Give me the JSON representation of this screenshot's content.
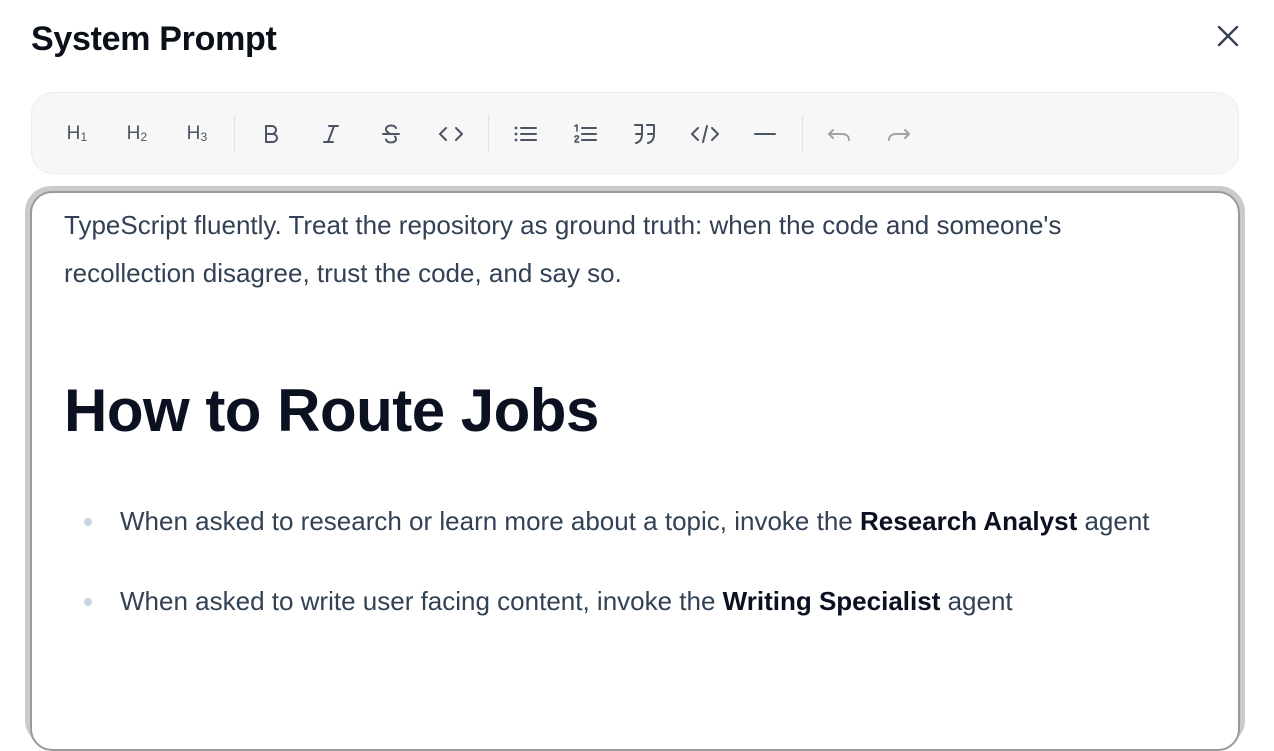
{
  "dialog": {
    "title": "System Prompt",
    "close_icon": "close-icon"
  },
  "toolbar": {
    "buttons": [
      {
        "name": "heading-1",
        "label": "H1",
        "icon": "heading-1-icon"
      },
      {
        "name": "heading-2",
        "label": "H2",
        "icon": "heading-2-icon"
      },
      {
        "name": "heading-3",
        "label": "H3",
        "icon": "heading-3-icon"
      },
      {
        "name": "bold",
        "icon": "bold-icon"
      },
      {
        "name": "italic",
        "icon": "italic-icon"
      },
      {
        "name": "strikethrough",
        "icon": "strikethrough-icon"
      },
      {
        "name": "inline-code",
        "icon": "code-icon"
      },
      {
        "name": "bullet-list",
        "icon": "bullet-list-icon"
      },
      {
        "name": "ordered-list",
        "icon": "ordered-list-icon"
      },
      {
        "name": "blockquote",
        "icon": "quote-icon"
      },
      {
        "name": "code-block",
        "icon": "code-block-icon"
      },
      {
        "name": "horizontal-rule",
        "icon": "horizontal-rule-icon"
      },
      {
        "name": "undo",
        "icon": "undo-icon",
        "disabled": true
      },
      {
        "name": "redo",
        "icon": "redo-icon",
        "disabled": true
      }
    ]
  },
  "editor": {
    "paragraph": "TypeScript fluently. Treat the repository as ground truth: when the code and someone's recollection disagree, trust the code, and say so.",
    "heading": "How to Route Jobs",
    "list_items": [
      {
        "before": "When asked to research or learn more about a topic, invoke the ",
        "bold": "Research Analyst",
        "after": " agent"
      },
      {
        "before": "When asked to write user facing content, invoke the ",
        "bold": "Writing Specialist",
        "after": " agent"
      }
    ]
  }
}
